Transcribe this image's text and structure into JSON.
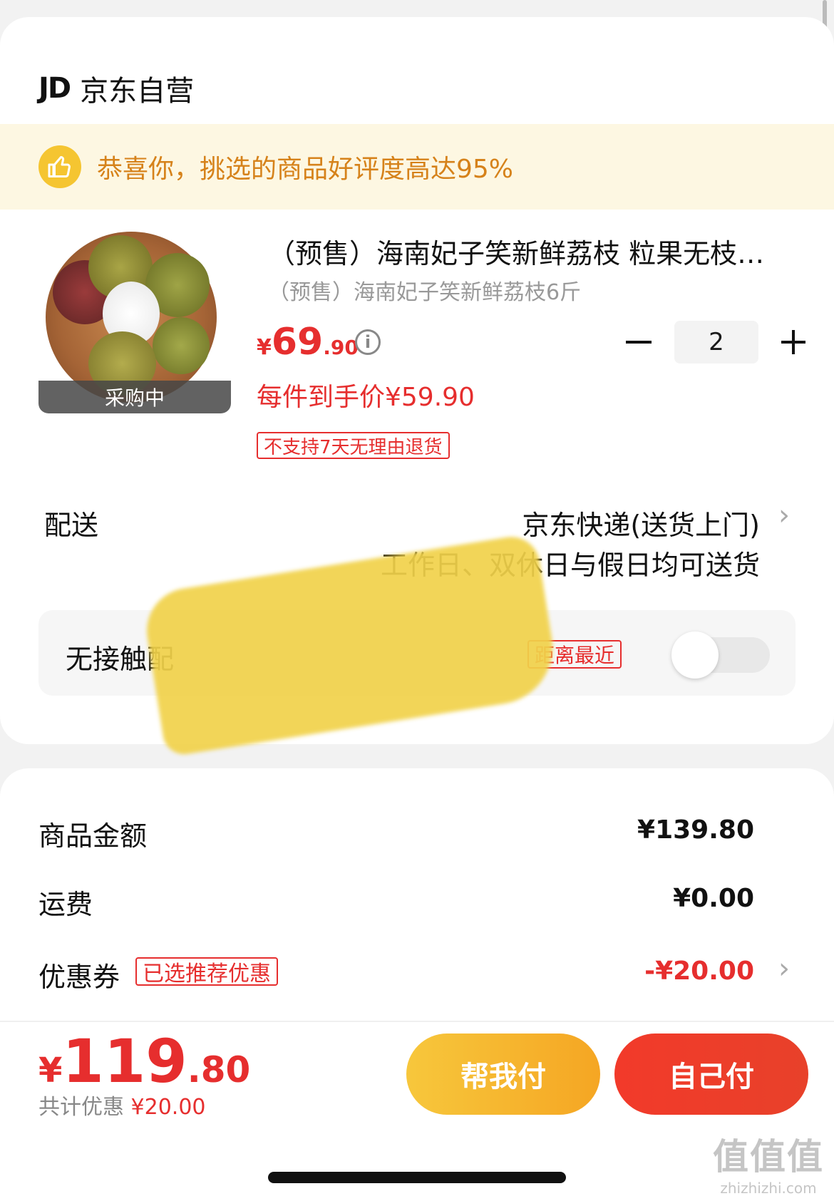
{
  "store": {
    "logo": "JD",
    "name": "京东自营"
  },
  "banner": {
    "icon": "thumbs-up-icon",
    "text": "恭喜你，挑选的商品好评度高达95%"
  },
  "product": {
    "title": "（预售）海南妃子笑新鲜荔枝 粒果无枝…",
    "subtitle": "（预售）海南妃子笑新鲜荔枝6斤",
    "status_badge": "采购中",
    "price_currency": "¥",
    "price_int": "69",
    "price_dec": ".90",
    "info_icon": "i",
    "quantity": "2",
    "per_item_price": "每件到手价¥59.90",
    "return_policy": "不支持7天无理由退货"
  },
  "shipping": {
    "label": "配送",
    "method": "京东快递(送货上门)",
    "days": "工作日、双休日与假日均可送货",
    "chevron": "›"
  },
  "contactless": {
    "label": "无接触配",
    "tag": "距离最近",
    "enabled": false
  },
  "summary": {
    "goods_label": "商品金额",
    "goods_value": "¥139.80",
    "freight_label": "运费",
    "freight_value": "¥0.00",
    "coupon_label": "优惠券",
    "coupon_tag": "已选推荐优惠",
    "coupon_value": "-¥20.00",
    "chevron": "›"
  },
  "footer": {
    "total_currency": "¥",
    "total_int": "119",
    "total_dec": ".80",
    "discount_label": "共计优惠",
    "discount_value": "¥20.00",
    "help_pay": "帮我付",
    "self_pay": "自己付"
  },
  "watermark": {
    "logo": "值值值",
    "site": "zhizhizhi.com"
  },
  "colors": {
    "accent_red": "#e62e2e",
    "banner_bg": "#fdf7e2",
    "banner_text": "#d6821a",
    "help_btn": "#f5a623",
    "self_btn": "#ef3b2a"
  }
}
